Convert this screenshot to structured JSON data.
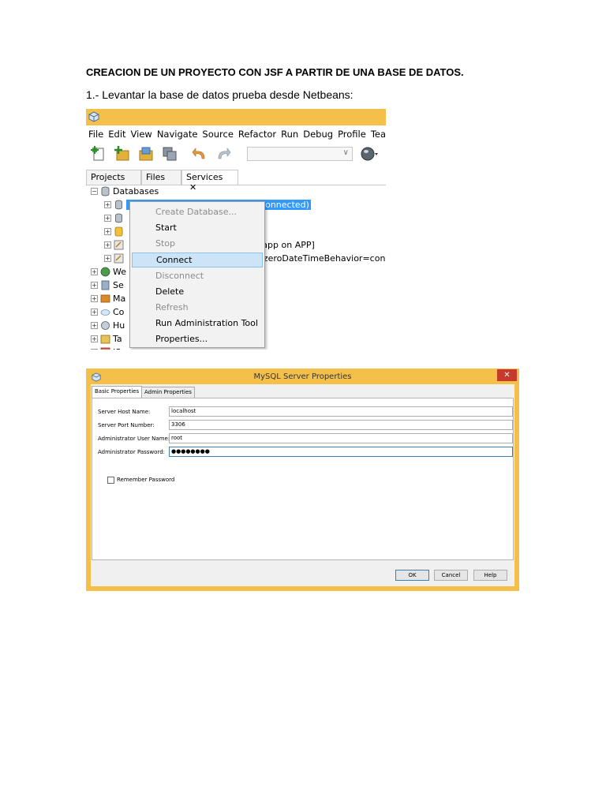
{
  "document": {
    "title": "CREACION DE UN PROYECTO CON JSF A PARTIR DE UNA BASE DE DATOS.",
    "step1": "1.- Levantar la base de datos prueba desde Netbeans:"
  },
  "netbeans": {
    "menus": [
      "File",
      "Edit",
      "View",
      "Navigate",
      "Source",
      "Refactor",
      "Run",
      "Debug",
      "Profile",
      "Team"
    ],
    "tabs": {
      "projects": "Projects",
      "files": "Files",
      "services": "Services",
      "close": "✕"
    },
    "tree": {
      "databases": "Databases",
      "selected_node": "[disconnected)",
      "conn_app": "[app on APP]",
      "conn_params": "?zeroDateTimeBehavior=convert",
      "partial_items": [
        "We",
        "Se",
        "Ma",
        "Co",
        "Hu",
        "Ta",
        "JS"
      ]
    },
    "context_menu": [
      {
        "label": "Create Database...",
        "disabled": true
      },
      {
        "label": "Start",
        "disabled": false
      },
      {
        "label": "Stop",
        "disabled": true
      },
      {
        "label": "Connect",
        "disabled": false,
        "highlighted": true
      },
      {
        "label": "Disconnect",
        "disabled": true
      },
      {
        "label": "Delete",
        "disabled": false
      },
      {
        "label": "Refresh",
        "disabled": true
      },
      {
        "label": "Run Administration Tool",
        "disabled": false
      },
      {
        "label": "Properties...",
        "disabled": false
      }
    ]
  },
  "dialog": {
    "title": "MySQL Server Properties",
    "close": "✕",
    "tabs": [
      "Basic Properties",
      "Admin Properties"
    ],
    "fields": {
      "host_label": "Server Host Name:",
      "host_value": "localhost",
      "port_label": "Server Port Number:",
      "port_value": "3306",
      "user_label": "Administrator User Name:",
      "user_value": "root",
      "password_label": "Administrator Password:",
      "password_value": "●●●●●●●●"
    },
    "remember_label": "Remember Password",
    "buttons": {
      "ok": "OK",
      "cancel": "Cancel",
      "help": "Help"
    }
  },
  "colors": {
    "titlebar": "#f5c04a",
    "selection": "#3399ff",
    "hover": "#cce4f7",
    "close": "#c7392b"
  }
}
